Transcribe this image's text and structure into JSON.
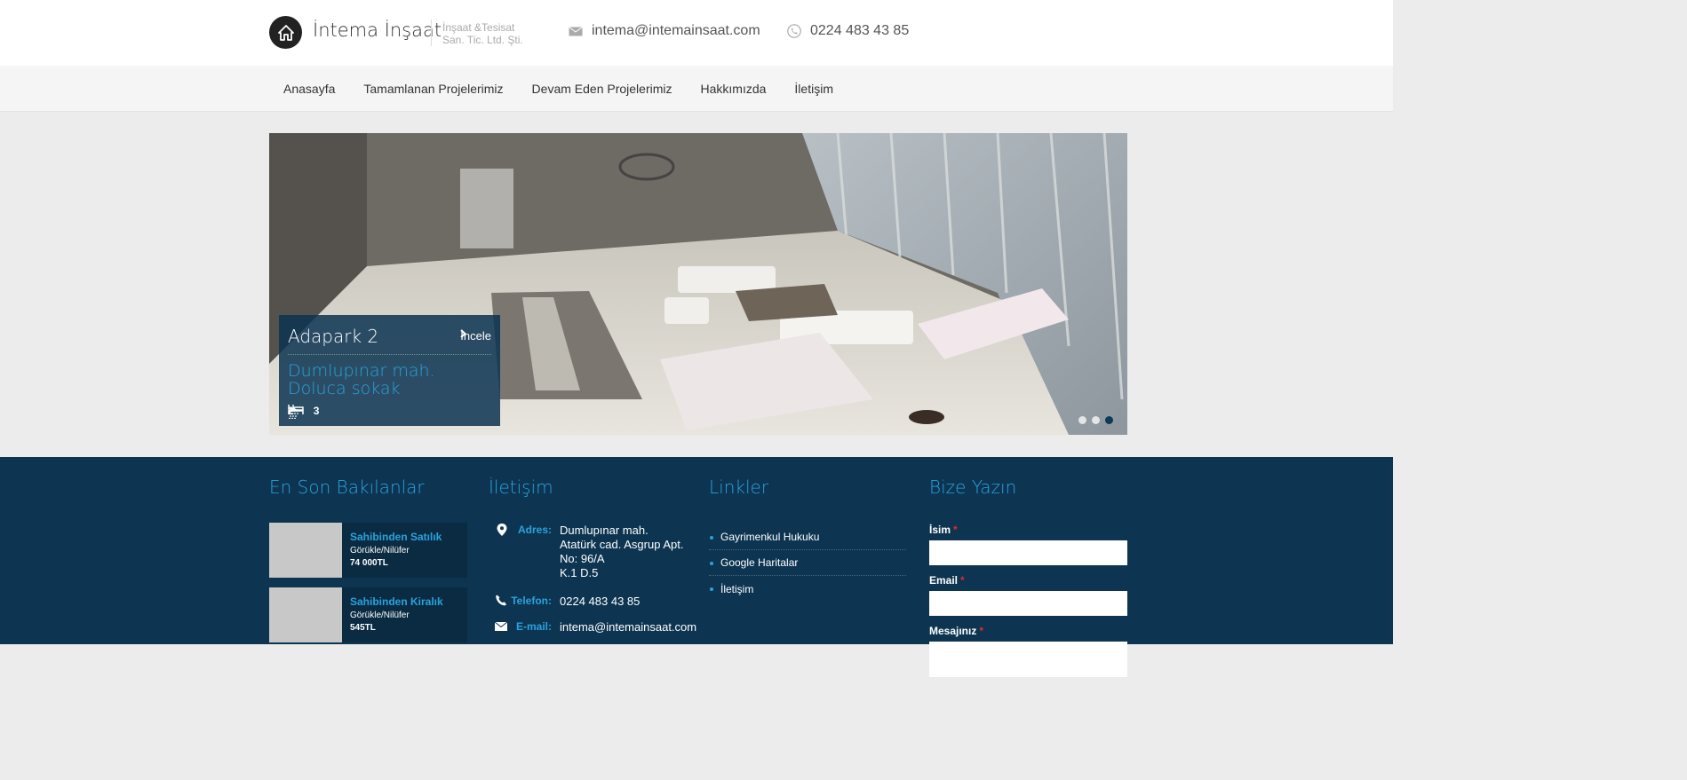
{
  "header": {
    "brand": "İntema İnşaat",
    "tagline_line1": "İnşaat &Tesisat",
    "tagline_line2": "San. Tic. Ltd. Şti.",
    "email": "intema@intemainsaat.com",
    "phone": "0224 483 43 85"
  },
  "nav": {
    "items": [
      {
        "label": "Anasayfa"
      },
      {
        "label": "Tamamlanan Projelerimiz"
      },
      {
        "label": "Devam Eden Projelerimiz"
      },
      {
        "label": "Hakkımızda"
      },
      {
        "label": "İletişim"
      }
    ]
  },
  "slider": {
    "title": "Adapark 2",
    "more_label": "İncele",
    "address_line1": "Dumlupınar mah.",
    "address_line2": "Doluca sokak",
    "baths": "2",
    "beds": "3",
    "active_dot": 3,
    "dot_count": 3
  },
  "footer": {
    "recent": {
      "title": "En Son Bakılanlar",
      "items": [
        {
          "title": "Sahibinden Satılık",
          "location": "Görükle/Nilüfer",
          "price": "74 000TL"
        },
        {
          "title": "Sahibinden Kiralık",
          "location": "Görükle/Nilüfer",
          "price": "545TL"
        }
      ]
    },
    "contact": {
      "title": "İletişim",
      "address_label": "Adres:",
      "address_lines": [
        "Dumlupınar mah.",
        "Atatürk cad. Asgrup Apt.",
        "No: 96/A",
        "K.1 D.5"
      ],
      "phone_label": "Telefon:",
      "phone": "0224 483 43 85",
      "email_label": "E-mail:",
      "email": "intema@intemainsaat.com"
    },
    "links": {
      "title": "Linkler",
      "items": [
        {
          "label": "Gayrimenkul Hukuku"
        },
        {
          "label": "Google Haritalar"
        },
        {
          "label": "İletişim"
        }
      ]
    },
    "form": {
      "title": "Bize Yazın",
      "name_label": "İsim",
      "email_label": "Email",
      "message_label": "Mesajınız",
      "required_mark": "*"
    }
  },
  "colors": {
    "accent": "#29a3df",
    "footer_bg": "#0d3450",
    "caption_bg": "#0a3250"
  }
}
